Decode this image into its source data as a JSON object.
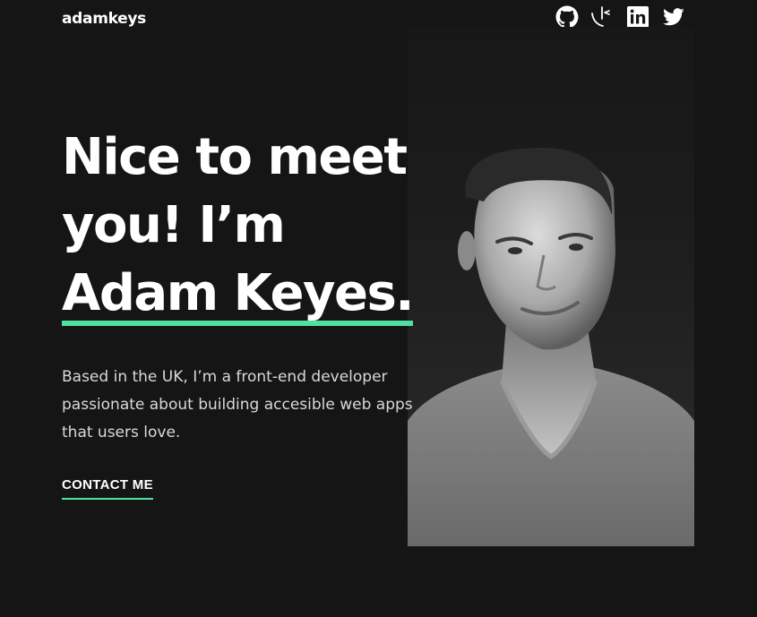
{
  "header": {
    "logo": "adamkeys",
    "social_links": [
      {
        "icon": "github-icon"
      },
      {
        "icon": "frontend-mentor-icon"
      },
      {
        "icon": "linkedin-icon"
      },
      {
        "icon": "twitter-icon"
      }
    ]
  },
  "hero": {
    "headline_line1": "Nice to meet",
    "headline_line2": "you! I’m",
    "headline_name": "Adam Keyes.",
    "bio": "Based in the UK, I’m a front-end developer passionate about building accesible web apps that users love.",
    "cta_label": "CONTACT ME",
    "photo_alt": "Adam Keyes portrait"
  },
  "colors": {
    "background": "#151515",
    "accent": "#4ee1a0",
    "text": "#ffffff",
    "muted_text": "#d9d9d9"
  }
}
